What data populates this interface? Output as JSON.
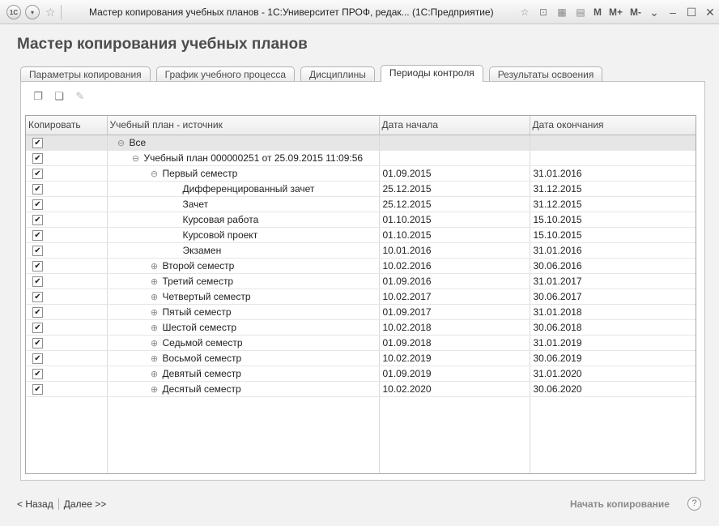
{
  "window": {
    "app_icon": "1C",
    "title": "Мастер копирования учебных планов - 1С:Университет ПРОФ, редак... (1С:Предприятие)",
    "memory_buttons": [
      "M",
      "M+",
      "M-"
    ]
  },
  "form": {
    "title": "Мастер копирования учебных планов",
    "tabs": [
      {
        "label": "Параметры копирования"
      },
      {
        "label": "График учебного процесса"
      },
      {
        "label": "Дисциплины"
      },
      {
        "label": "Периоды контроля",
        "active": true
      },
      {
        "label": "Результаты освоения"
      }
    ]
  },
  "table": {
    "columns": [
      "Копировать",
      "Учебный план - источник",
      "Дата начала",
      "Дата окончания"
    ],
    "rows": [
      {
        "checked": true,
        "toggle": "⊖",
        "level": 0,
        "name": "Все",
        "start": "",
        "end": "",
        "selected": true
      },
      {
        "checked": true,
        "toggle": "⊖",
        "level": 1,
        "name": "Учебный план 000000251 от 25.09.2015 11:09:56",
        "start": "",
        "end": ""
      },
      {
        "checked": true,
        "toggle": "⊖",
        "level": 2,
        "name": "Первый семестр",
        "start": "01.09.2015",
        "end": "31.01.2016"
      },
      {
        "checked": true,
        "toggle": "",
        "level": 3,
        "name": "Дифференцированный зачет",
        "start": "25.12.2015",
        "end": "31.12.2015"
      },
      {
        "checked": true,
        "toggle": "",
        "level": 3,
        "name": "Зачет",
        "start": "25.12.2015",
        "end": "31.12.2015"
      },
      {
        "checked": true,
        "toggle": "",
        "level": 3,
        "name": "Курсовая работа",
        "start": "01.10.2015",
        "end": "15.10.2015"
      },
      {
        "checked": true,
        "toggle": "",
        "level": 3,
        "name": "Курсовой проект",
        "start": "01.10.2015",
        "end": "15.10.2015"
      },
      {
        "checked": true,
        "toggle": "",
        "level": 3,
        "name": "Экзамен",
        "start": "10.01.2016",
        "end": "31.01.2016"
      },
      {
        "checked": true,
        "toggle": "⊕",
        "level": 2,
        "name": "Второй семестр",
        "start": "10.02.2016",
        "end": "30.06.2016"
      },
      {
        "checked": true,
        "toggle": "⊕",
        "level": 2,
        "name": "Третий семестр",
        "start": "01.09.2016",
        "end": "31.01.2017"
      },
      {
        "checked": true,
        "toggle": "⊕",
        "level": 2,
        "name": "Четвертый семестр",
        "start": "10.02.2017",
        "end": "30.06.2017"
      },
      {
        "checked": true,
        "toggle": "⊕",
        "level": 2,
        "name": "Пятый семестр",
        "start": "01.09.2017",
        "end": "31.01.2018"
      },
      {
        "checked": true,
        "toggle": "⊕",
        "level": 2,
        "name": "Шестой семестр",
        "start": "10.02.2018",
        "end": "30.06.2018"
      },
      {
        "checked": true,
        "toggle": "⊕",
        "level": 2,
        "name": "Седьмой семестр",
        "start": "01.09.2018",
        "end": "31.01.2019"
      },
      {
        "checked": true,
        "toggle": "⊕",
        "level": 2,
        "name": "Восьмой семестр",
        "start": "10.02.2019",
        "end": "30.06.2019"
      },
      {
        "checked": true,
        "toggle": "⊕",
        "level": 2,
        "name": "Девятый семестр",
        "start": "01.09.2019",
        "end": "31.01.2020"
      },
      {
        "checked": true,
        "toggle": "⊕",
        "level": 2,
        "name": "Десятый семестр",
        "start": "10.02.2020",
        "end": "30.06.2020"
      }
    ]
  },
  "footer": {
    "back_label": "< Назад",
    "next_label": "Далее >>",
    "start_label": "Начать копирование",
    "help_label": "?"
  },
  "icons": {
    "check": "✔",
    "toolbar": [
      "check-all-icon",
      "uncheck-all-icon",
      "edit-icon"
    ]
  }
}
